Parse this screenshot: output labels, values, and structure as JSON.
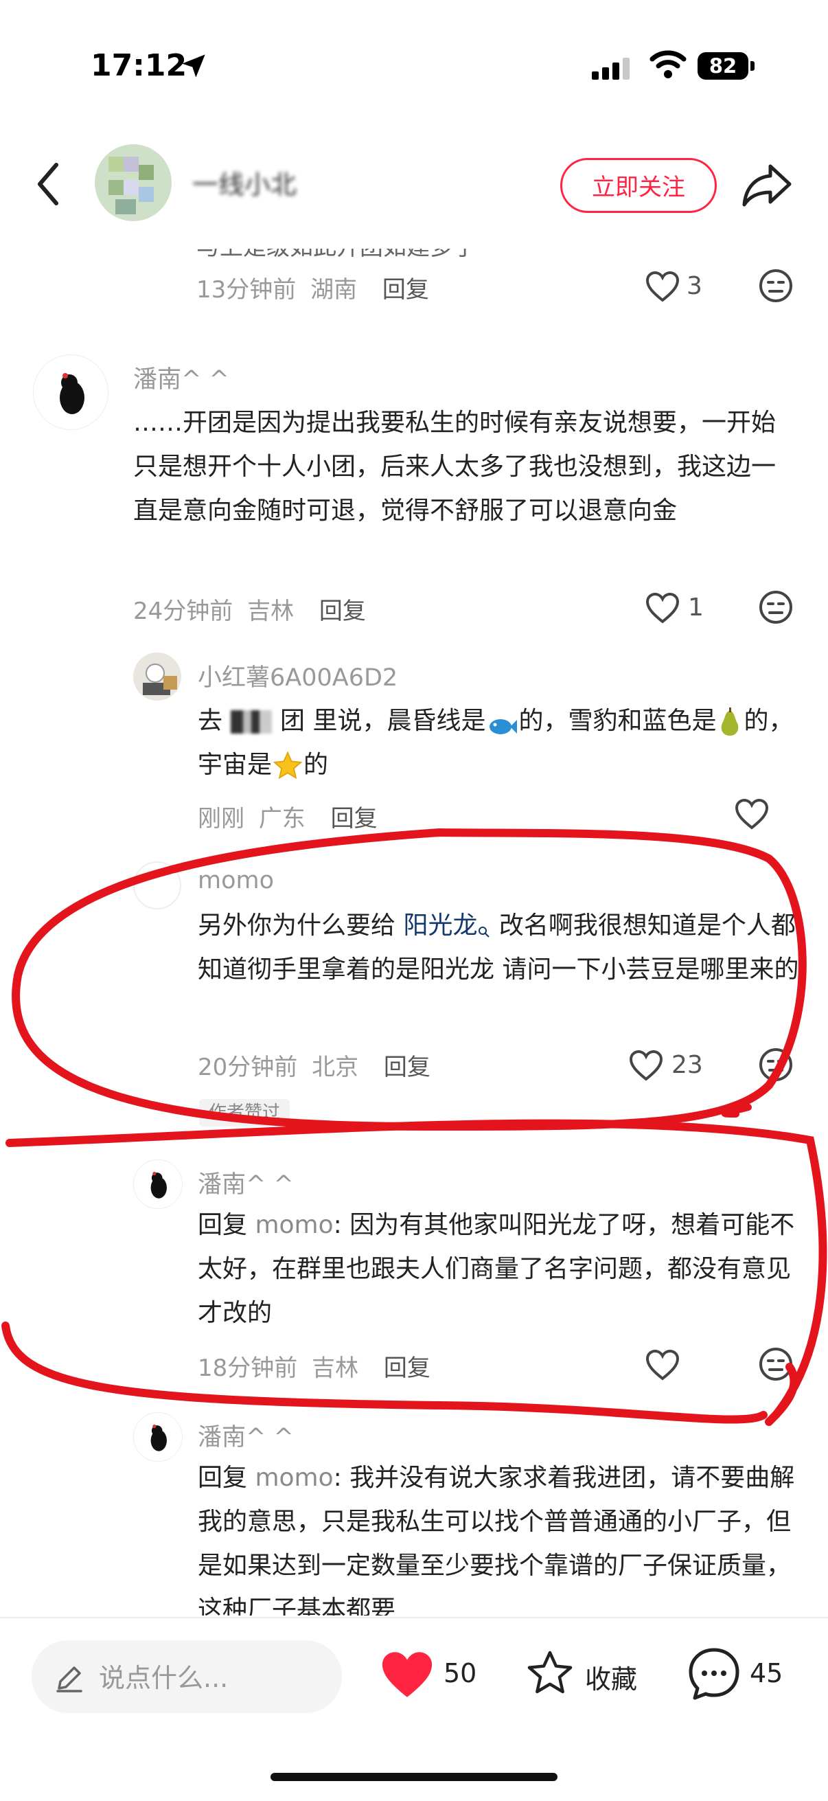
{
  "status_bar": {
    "time": "17:12",
    "battery": "82"
  },
  "header": {
    "username": "一线小北",
    "follow_label": "立即关注"
  },
  "top_partial": {
    "text": "与上是级如此开团如建多了",
    "time": "13分钟前",
    "location": "湖南",
    "reply": "回复",
    "likes": "3"
  },
  "comments": [
    {
      "user": "潘南^ ^",
      "text": "……开团是因为提出我要私生的时候有亲友说想要，一开始只是想开个十人小团，后来人太多了我也没想到，我这边一直是意向金随时可退，觉得不舒服了可以退意向金",
      "time": "24分钟前",
      "location": "吉林",
      "reply": "回复",
      "likes": "1"
    },
    {
      "user": "小红薯6A00A6D2",
      "text_a": "去",
      "text_b": "团 里说，晨昏线是",
      "text_c": "的，雪豹和蓝色是",
      "text_d": "的，宇宙是",
      "text_e": "的",
      "time": "刚刚",
      "location": "广东",
      "reply": "回复"
    },
    {
      "user": "momo",
      "text_pre": "另外你为什么要给 ",
      "link": "阳光龙",
      "text_post": " 改名啊我很想知道是个人都知道彻手里拿着的是阳光龙 请问一下小芸豆是哪里来的",
      "time": "20分钟前",
      "location": "北京",
      "reply": "回复",
      "likes": "23",
      "tag": "作者赞过"
    },
    {
      "user": "潘南^ ^",
      "reply_prefix": "回复 ",
      "mention": "momo",
      "text": ": 因为有其他家叫阳光龙了呀，想着可能不太好，在群里也跟夫人们商量了名字问题，都没有意见才改的",
      "time": "18分钟前",
      "location": "吉林",
      "reply": "回复"
    },
    {
      "user": "潘南^ ^",
      "reply_prefix": "回复 ",
      "mention": "momo",
      "text": ": 我并没有说大家求着我进团，请不要曲解我的意思，只是我私生可以找个普普通通的小厂子，但是如果达到一定数量至少要找个靠谱的厂子保证质量，这种厂子基本都要"
    }
  ],
  "bottom_bar": {
    "input_placeholder": "说点什么...",
    "likes": "50",
    "collect_label": "收藏",
    "comments": "45"
  },
  "colors": {
    "accent": "#ff2442",
    "annotation": "#e4141c",
    "link": "#13386c"
  }
}
